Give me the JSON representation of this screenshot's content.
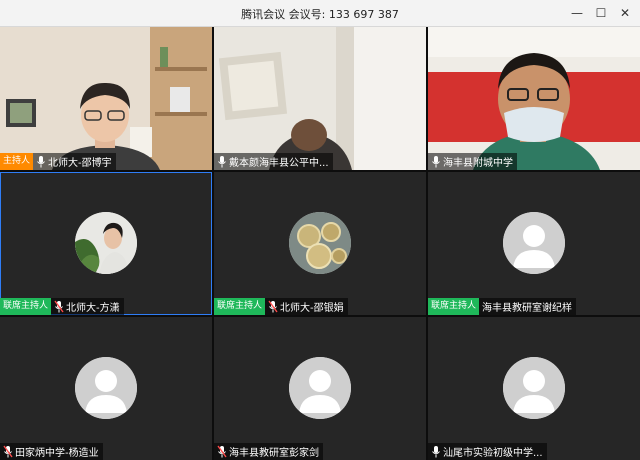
{
  "window": {
    "title": "腾讯会议  会议号: 133 697 387",
    "controls": [
      "—",
      "☐",
      "✕"
    ]
  },
  "badges": {
    "host": "主持人",
    "cohost": "联席主持人"
  },
  "participants": [
    {
      "name": "北师大-邵博宇",
      "role": "host",
      "mic": "on"
    },
    {
      "name": "戴本颜海丰县公平中...",
      "role": "",
      "mic": "on"
    },
    {
      "name": "海丰县附城中学",
      "role": "",
      "mic": "on"
    },
    {
      "name": "北师大-方潇",
      "role": "cohost",
      "mic": "muted"
    },
    {
      "name": "北师大-邵银娟",
      "role": "cohost",
      "mic": "muted"
    },
    {
      "name": "海丰县教研室谢纪样",
      "role": "cohost",
      "mic": "none"
    },
    {
      "name": "田家炳中学-杨造业",
      "role": "",
      "mic": "muted"
    },
    {
      "name": "海丰县教研室彭家剑",
      "role": "",
      "mic": "muted"
    },
    {
      "name": "汕尾市实验初级中学...",
      "role": "",
      "mic": "on"
    }
  ]
}
